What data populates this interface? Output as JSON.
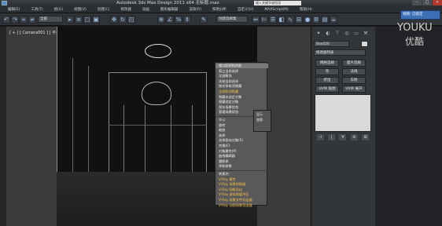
{
  "window": {
    "title": "Autodesk 3ds Max Design 2011 x64        无标题.max",
    "help_search_placeholder": "键入关键字或短语",
    "controls": [
      "–",
      "□",
      "✕"
    ]
  },
  "menubar": {
    "items": [
      "编辑(E)",
      "工具(T)",
      "组(G)",
      "视图(V)",
      "创建(C)",
      "修改器",
      "动画",
      "图形编辑器",
      "渲染(R)",
      "照明分析",
      "自定义(U)",
      "MAXScript(M)",
      "帮助(H)"
    ]
  },
  "toolbar": {
    "view_dropdown": "全部",
    "selection_set": "创建选择集",
    "icons": [
      "undo-icon",
      "redo-icon",
      "link-icon",
      "unlink-icon",
      "bind-icon",
      "select-icon",
      "select-by-name-icon",
      "move-icon",
      "rotate-icon",
      "scale-icon",
      "snap-icon",
      "angle-snap-icon",
      "percent-snap-icon",
      "mirror-icon",
      "align-icon",
      "layer-icon",
      "curve-editor-icon",
      "schematic-icon",
      "material-editor-icon",
      "render-setup-icon",
      "render-icon"
    ]
  },
  "viewport": {
    "label": "[ + ] [ Camera001 ] [ 平滑 + 高光 ]"
  },
  "quad_menu": {
    "items": [
      {
        "label": "视口照明和阴影",
        "style": "head"
      },
      {
        "label": "孤立当前选择",
        "style": "normal"
      },
      {
        "label": "全部解冻",
        "style": "normal"
      },
      {
        "label": "冻结当前选择",
        "style": "normal"
      },
      {
        "label": "按名称取消隐藏",
        "style": "normal"
      },
      {
        "label": "全部取消隐藏",
        "style": "hl"
      },
      {
        "label": "隐藏未选定对象",
        "style": "normal"
      },
      {
        "label": "隐藏选定对象",
        "style": "normal"
      },
      {
        "label": "保存场景状态",
        "style": "normal"
      },
      {
        "label": "管理场景状态",
        "style": "normal"
      },
      {
        "label": "移动",
        "style": "dim"
      },
      {
        "label": "旋转",
        "style": "normal"
      },
      {
        "label": "缩放",
        "style": "normal"
      },
      {
        "label": "选择",
        "style": "normal"
      },
      {
        "label": "选择类似对象(S)",
        "style": "normal"
      },
      {
        "label": "克隆(C)",
        "style": "normal"
      },
      {
        "label": "对象属性(P)",
        "style": "normal"
      },
      {
        "label": "曲线编辑器",
        "style": "normal"
      },
      {
        "label": "摄影表",
        "style": "normal"
      },
      {
        "label": "关联参数",
        "style": "normal"
      },
      {
        "label": "转换为:",
        "style": "normal"
      },
      {
        "label": "V-Ray 属性",
        "style": "hl"
      },
      {
        "label": "V-Ray 场景转换器",
        "style": "hl"
      },
      {
        "label": "V-Ray 网格导出",
        "style": "hl"
      },
      {
        "label": "V-Ray 虚拟帧缓冲区",
        "style": "hl"
      },
      {
        "label": "V-Ray 场景文件导出器",
        "style": "hl"
      },
      {
        "label": "V-Ray 动画场景导出器",
        "style": "hl"
      }
    ],
    "side_items": [
      "显示",
      "变换"
    ]
  },
  "command_panel": {
    "object_name": "Box026",
    "modifier_list": "修改器列表",
    "buttons": [
      [
        "网格选择",
        "面片选择"
      ],
      [
        "壳",
        "法线"
      ],
      [
        "挤出",
        "车削"
      ],
      [
        "UVW 贴图",
        "UVW 展开"
      ]
    ],
    "stack_tools": [
      "⊣",
      "|",
      "∀",
      "⊘",
      "⊞"
    ]
  },
  "watermark": {
    "en": "YOUKU",
    "cn": "优酷"
  },
  "tooltip": {
    "text": "视频: 已锁定"
  },
  "colors": {
    "accent_highlight": "#f5c04a",
    "titlebar": "#2a2d31",
    "viewport_bg": "#3b3b3b",
    "close_button": "#b03a2e"
  }
}
